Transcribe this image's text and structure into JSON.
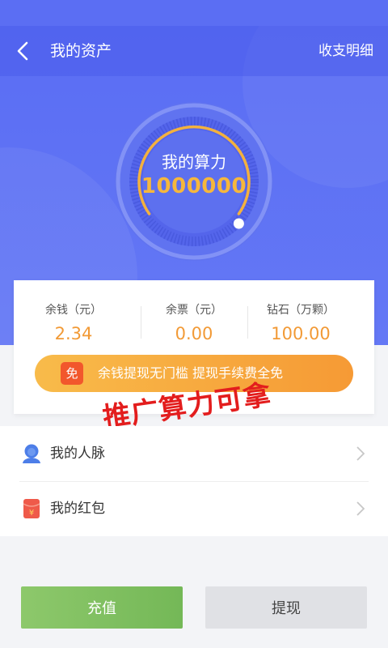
{
  "nav": {
    "title": "我的资产",
    "right_link": "收支明细"
  },
  "gauge": {
    "label": "我的算力",
    "value": "1000000"
  },
  "stats": [
    {
      "label": "余钱（元）",
      "value": "2.34"
    },
    {
      "label": "余票（元）",
      "value": "0.00"
    },
    {
      "label": "钻石（万颗）",
      "value": "100.00"
    }
  ],
  "promo": {
    "badge": "免",
    "text": "余钱提现无门槛  提现手续费全免"
  },
  "watermark": "推广算力可拿",
  "menu": [
    {
      "label": "我的人脉",
      "icon": "people-icon"
    },
    {
      "label": "我的红包",
      "icon": "red-envelope-icon"
    }
  ],
  "buttons": {
    "recharge": "充值",
    "withdraw": "提现"
  },
  "colors": {
    "primary": "#5b6ef3",
    "accent": "#f6b73c",
    "value_orange": "#f29a36",
    "green": "#7cbf5e",
    "promo_red": "#f2572c"
  }
}
